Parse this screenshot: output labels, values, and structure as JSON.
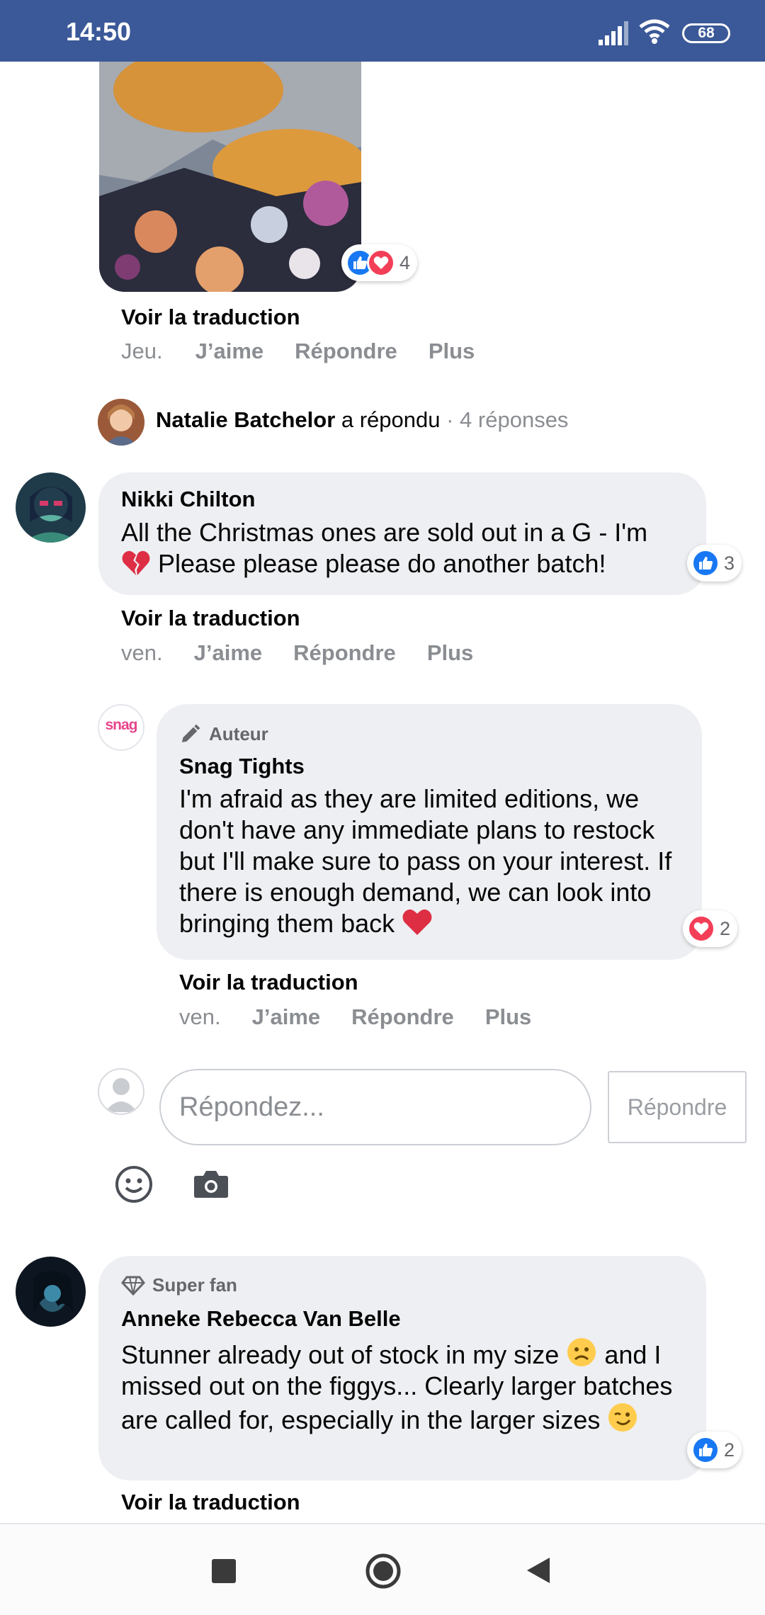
{
  "status_bar": {
    "time": "14:50",
    "battery": "68"
  },
  "photo_comment": {
    "reaction_count": "4",
    "translate": "Voir la traduction",
    "date": "Jeu.",
    "like": "J’aime",
    "reply": "Répondre",
    "more": "Plus"
  },
  "reply_summary": {
    "name": "Natalie Batchelor",
    "action": " a répondu",
    "count": " · 4 réponses"
  },
  "comments": [
    {
      "author": "Nikki Chilton",
      "text_line1": "All the Christmas ones are sold out in a G - I'm",
      "text_line2": " Please please please do another batch!",
      "reaction_count": "3",
      "translate": "Voir la traduction",
      "date": "ven.",
      "like": "J’aime",
      "reply": "Répondre",
      "more": "Plus"
    },
    {
      "badge": "Auteur",
      "author": "Snag Tights",
      "avatar_text": "snag",
      "text": "I'm afraid as they are limited editions, we don't have any immediate plans to restock but I'll make sure to pass on your interest. If there is enough demand, we can look into bringing them back",
      "reaction_count": "2",
      "translate": "Voir la traduction",
      "date": "ven.",
      "like": "J’aime",
      "reply": "Répondre",
      "more": "Plus"
    },
    {
      "badge": "Super fan",
      "author": "Anneke Rebecca Van Belle",
      "text_a": "Stunner already out of stock in my size",
      "text_b": " and I missed out on the figgys... Clearly larger batches are called for, especially in the larger sizes",
      "reaction_count": "2",
      "translate": "Voir la traduction"
    }
  ],
  "reply_box": {
    "placeholder": "Répondez...",
    "button": "Répondre"
  },
  "colors": {
    "header": "#3b5998",
    "like": "#1877f2",
    "love": "#f33e58",
    "bubble": "#eeeff2"
  }
}
